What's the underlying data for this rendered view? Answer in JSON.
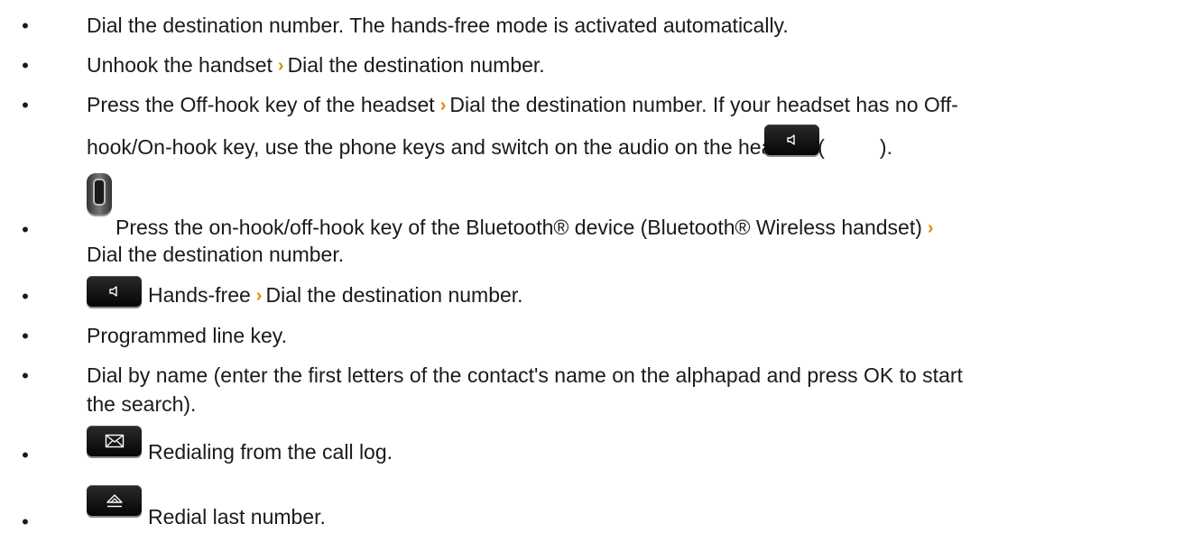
{
  "bullet_glyph": "•",
  "separator_glyph": "›",
  "items": [
    {
      "text": "Dial the destination number. The hands-free mode is activated automatically."
    },
    {
      "part1": "Unhook the handset",
      "part2": "Dial the destination number."
    },
    {
      "line1_part1": "Press the Off-hook key of the headset",
      "line1_part2": "Dial the destination number. If your headset has no Off-",
      "line2_part1": "hook/On-hook key, use the phone keys and switch on the audio on the headset (",
      "line2_part2": ").",
      "icon": "speaker-key-icon"
    },
    {
      "line1": "Press the on-hook/off-hook key of the Bluetooth® device (Bluetooth® Wireless handset)",
      "line2": "Dial the destination number.",
      "icon": "bluetooth-handset-icon"
    },
    {
      "part1": "Hands-free",
      "part2": "Dial the destination number.",
      "icon": "speaker-key-icon"
    },
    {
      "text": "Programmed line key."
    },
    {
      "line1": "Dial by name (enter the first letters of the contact's name on the alphapad and press OK to start",
      "line2": "the search)."
    },
    {
      "text": "Redialing from the call log.",
      "icon": "envelope-key-icon"
    },
    {
      "text": "Redial last number.",
      "icon": "redial-key-icon"
    }
  ],
  "colors": {
    "text": "#1a1a1a",
    "separator": "#e08a00",
    "key": "#0a0a0a"
  }
}
